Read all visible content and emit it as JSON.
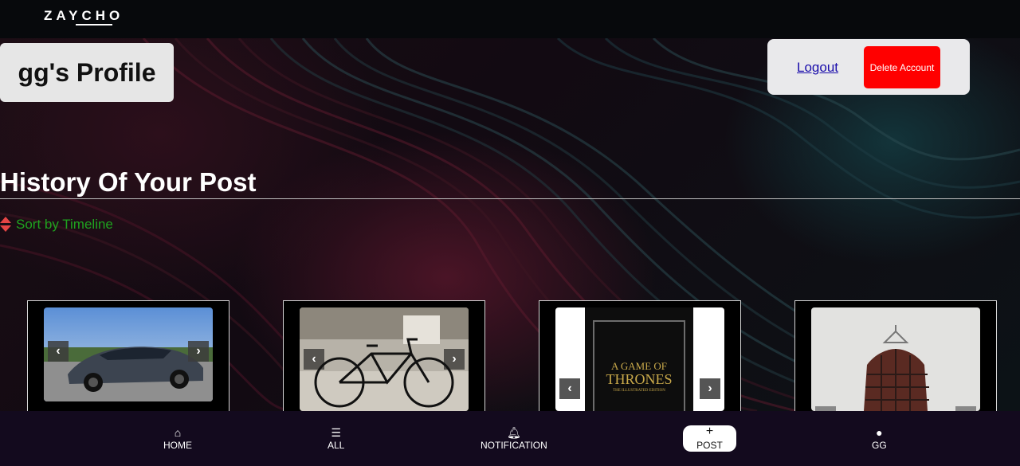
{
  "header": {
    "logo": "ZAYCHO"
  },
  "profile": {
    "title": "gg's Profile"
  },
  "account": {
    "logout_label": "Logout",
    "delete_label": "Delete Account"
  },
  "history": {
    "title": "History Of Your Post",
    "sort_label": "Sort by Timeline"
  },
  "posts": [
    {
      "image": "gray electric sedan car"
    },
    {
      "image": "black bicycle"
    },
    {
      "image": "A Game of Thrones book"
    },
    {
      "image": "plaid flannel shirt on hanger"
    }
  ],
  "book_cover": {
    "line1": "A GAME OF",
    "line2": "THRONES",
    "line3": "THE ILLUSTRATED EDITION"
  },
  "nav": {
    "home": "HOME",
    "all": "ALL",
    "notification": "NOTIFICATION",
    "post": "POST",
    "user": "GG"
  },
  "icons": {
    "prev": "‹",
    "next": "›",
    "home_icon": "home-icon",
    "list_icon": "list-icon",
    "bell_icon": "bell-icon",
    "plus_icon": "plus-icon",
    "user_icon": "user-icon"
  },
  "colors": {
    "delete": "#ff0000",
    "sort_text": "#1fa21f",
    "sort_icon": "#e64545",
    "nav_bg": "#130a1e"
  }
}
